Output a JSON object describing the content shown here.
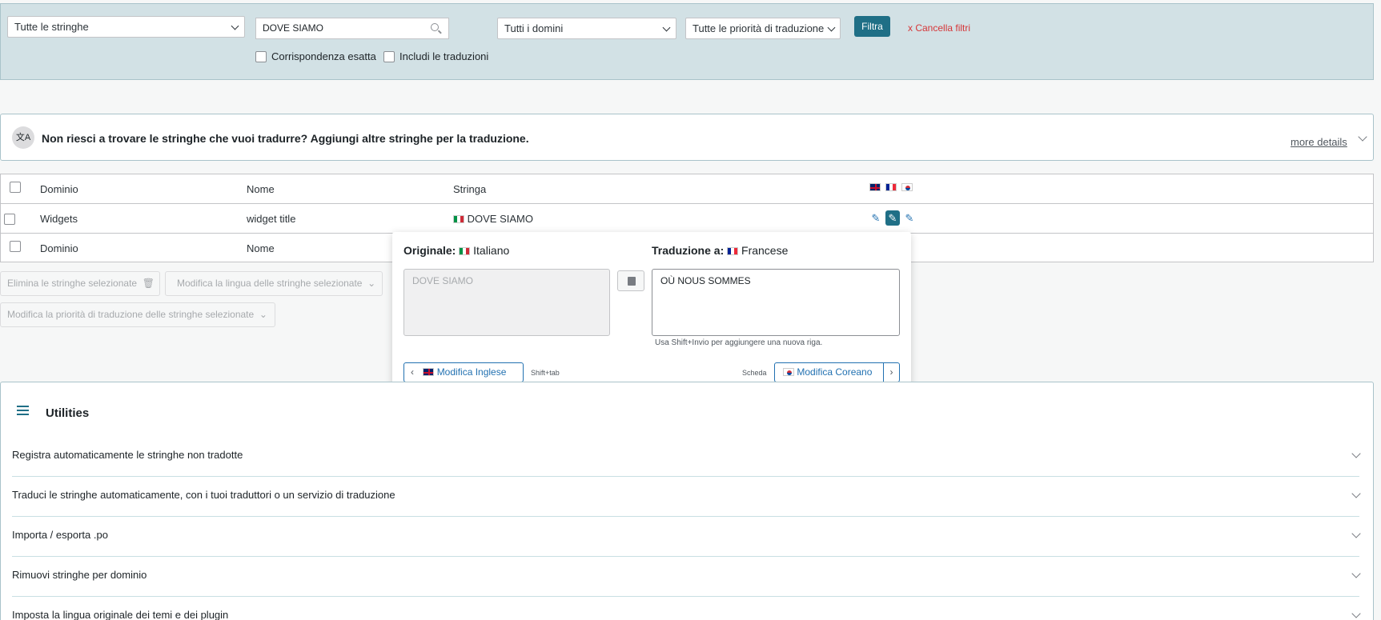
{
  "filters": {
    "strings_select": "Tutte le stringhe",
    "search_value": "DOVE SIAMO",
    "domains_select": "Tutti i domini",
    "priority_select": "Tutte le priorità di traduzione",
    "filter_button": "Filtra",
    "clear_filters": "x  Cancella filtri",
    "exact_match": "Corrispondenza esatta",
    "include_translations": "Includi le traduzioni"
  },
  "notice": {
    "icon_text": "文A",
    "message": "Non riesci a trovare le stringhe che vuoi tradurre? Aggiungi altre stringhe per la traduzione.",
    "more_details": "more details"
  },
  "table": {
    "headers": {
      "domain": "Dominio",
      "name": "Nome",
      "string": "Stringa"
    },
    "row": {
      "domain": "Widgets",
      "name": "widget title",
      "string": "DOVE SIAMO"
    },
    "footers": {
      "domain": "Dominio",
      "name": "Nome"
    }
  },
  "bulk": {
    "delete": "Elimina le stringhe selezionate",
    "change_language": "Modifica la lingua delle stringhe selezionate",
    "change_priority": "Modifica la priorità di traduzione delle stringhe selezionate"
  },
  "popup": {
    "original_label": "Originale:",
    "original_lang": "Italiano",
    "translation_label": "Traduzione a:",
    "translation_lang": "Francese",
    "original_text": "DOVE SIAMO",
    "translation_text": "OÙ NOUS SOMMES",
    "hint": "Usa Shift+Invio per aggiungere una nuova riga.",
    "prev_button": "Modifica Inglese",
    "prev_shortcut": "Shift+tab",
    "next_shortcut": "Scheda",
    "next_button": "Modifica Coreano"
  },
  "utilities": {
    "title": "Utilities",
    "items": [
      "Registra automaticamente le stringhe non tradotte",
      "Traduci le stringhe automaticamente, con i tuoi traduttori o un servizio di traduzione",
      "Importa / esporta .po",
      "Rimuovi stringhe per dominio",
      "Imposta la lingua originale dei temi e dei plugin"
    ]
  }
}
